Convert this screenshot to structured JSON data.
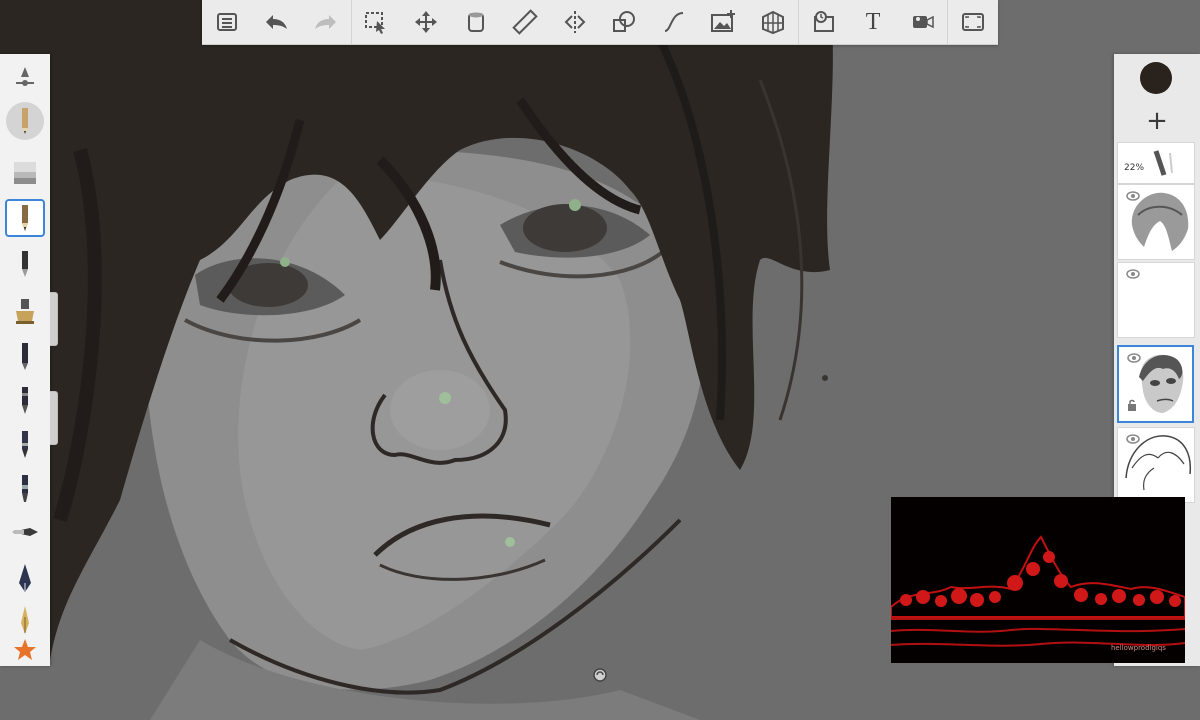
{
  "toolbar": {
    "items": [
      {
        "name": "menu-icon"
      },
      {
        "name": "undo-icon"
      },
      {
        "name": "redo-icon"
      },
      {
        "name": "selection-icon"
      },
      {
        "name": "transform-icon"
      },
      {
        "name": "fill-icon"
      },
      {
        "name": "ruler-icon"
      },
      {
        "name": "symmetry-icon"
      },
      {
        "name": "shapes-icon"
      },
      {
        "name": "stroke-tool-icon"
      },
      {
        "name": "image-add-icon"
      },
      {
        "name": "perspective-icon"
      },
      {
        "name": "timelapse-icon"
      },
      {
        "name": "text-icon",
        "label": "T"
      },
      {
        "name": "record-icon"
      },
      {
        "name": "fullscreen-icon"
      }
    ]
  },
  "brushes": {
    "items": [
      {
        "name": "brush-settings-icon"
      },
      {
        "name": "pencil-brush",
        "highlight": true
      },
      {
        "name": "eraser-brush"
      },
      {
        "name": "pencil-brush-selected",
        "selected": true
      },
      {
        "name": "ballpoint-pen-brush"
      },
      {
        "name": "airbrush-brush"
      },
      {
        "name": "marker-brush"
      },
      {
        "name": "felt-pen-brush"
      },
      {
        "name": "fine-pen-brush"
      },
      {
        "name": "chisel-marker-brush"
      },
      {
        "name": "paint-brush"
      },
      {
        "name": "ink-pen-brush"
      },
      {
        "name": "calligraphy-brush"
      },
      {
        "name": "favorites-star-icon"
      }
    ]
  },
  "layers": {
    "current_color": "#2a221d",
    "opacity_label": "22%",
    "items": [
      {
        "name": "layer-brush-preview",
        "has_eye": false
      },
      {
        "name": "layer-hair-sketch",
        "has_eye": true
      },
      {
        "name": "layer-empty",
        "has_eye": true
      },
      {
        "name": "layer-face-active",
        "has_eye": true,
        "active": true,
        "locked": true
      },
      {
        "name": "layer-hair-lineart",
        "has_eye": true
      }
    ]
  },
  "overlay": {
    "watermark": "hellowprodigiqs"
  },
  "colors": {
    "accent": "#3b86d8",
    "toolbar_bg": "#ebebeb",
    "canvas_bg": "#6d6d6d"
  }
}
